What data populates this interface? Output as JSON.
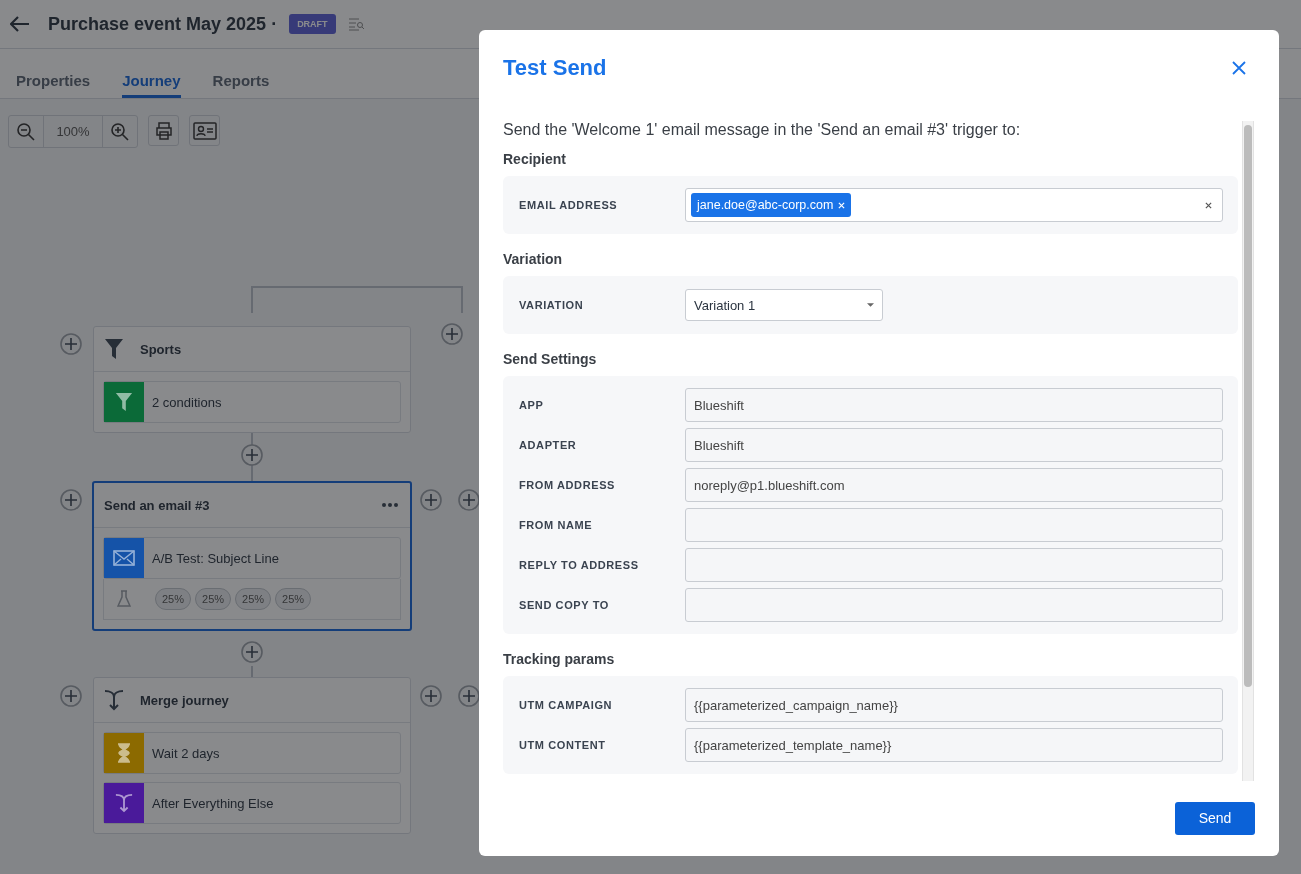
{
  "header": {
    "title": "Purchase event May 2025 ·",
    "badge": "DRAFT"
  },
  "tabs": [
    {
      "label": "Properties",
      "selected": false
    },
    {
      "label": "Journey",
      "selected": true
    },
    {
      "label": "Reports",
      "selected": false
    }
  ],
  "toolbar": {
    "zoom": "100%"
  },
  "nodes": [
    {
      "kind": "filter",
      "title": "Sports",
      "selected": false,
      "steps": [
        {
          "kind": "filter",
          "label": "2 conditions",
          "color": "#0b6a38"
        }
      ]
    },
    {
      "kind": "email",
      "title": "Send an email #3",
      "selected": true,
      "steps": [
        {
          "kind": "email",
          "label": "A/B Test: Subject Line",
          "color": "#1553a8"
        }
      ],
      "variants": [
        "25%",
        "25%",
        "25%",
        "25%"
      ]
    },
    {
      "kind": "merge",
      "title": "Merge journey",
      "selected": false,
      "steps": [
        {
          "kind": "wait",
          "label": "Wait 2 days",
          "color": "#8c6a00"
        },
        {
          "kind": "merge",
          "label": "After Everything Else",
          "color": "#4a1a9a"
        }
      ]
    }
  ],
  "modal": {
    "title": "Test Send",
    "intro": "Send the 'Welcome 1' email message in the 'Send an email #3' trigger to:",
    "sections": [
      {
        "heading": "Recipient",
        "rows": [
          {
            "kind": "tags",
            "label": "EMAIL ADDRESS",
            "tags": [
              "jane.doe@abc-corp.com"
            ]
          }
        ]
      },
      {
        "heading": "Variation",
        "rows": [
          {
            "kind": "select",
            "label": "VARIATION",
            "value": "Variation 1"
          }
        ]
      },
      {
        "heading": "Send Settings",
        "rows": [
          {
            "kind": "text",
            "label": "APP",
            "value": "Blueshift"
          },
          {
            "kind": "text",
            "label": "ADAPTER",
            "value": "Blueshift"
          },
          {
            "kind": "text",
            "label": "FROM ADDRESS",
            "value": "noreply@p1.blueshift.com"
          },
          {
            "kind": "text",
            "label": "FROM NAME"
          },
          {
            "kind": "text",
            "label": "REPLY TO ADDRESS"
          },
          {
            "kind": "text",
            "label": "SEND COPY TO"
          }
        ]
      },
      {
        "heading": "Tracking params",
        "rows": [
          {
            "kind": "text",
            "label": "UTM CAMPAIGN",
            "value": "{{parameterized_campaign_name}}"
          },
          {
            "kind": "text",
            "label": "UTM CONTENT",
            "value": "{{parameterized_template_name}}"
          }
        ]
      }
    ],
    "send": "Send"
  }
}
